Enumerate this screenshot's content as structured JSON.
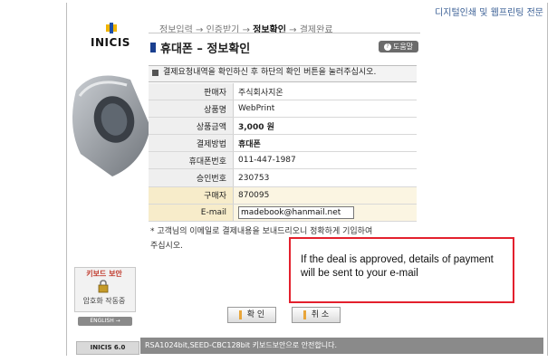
{
  "header": {
    "banner": "디지털인쇄 및 웹프린팅 전문",
    "steps": [
      "정보입력",
      "인증받기",
      "정보확인",
      "결제완료"
    ],
    "step_arrow": "→",
    "active_step": "정보확인"
  },
  "brand": {
    "logo_text": "INICIS",
    "badge_text": "INICIS 6.0"
  },
  "keyboard_security": {
    "title": "키보드 보안",
    "status": "암호화 작동중",
    "english_label": "ENGLISH →"
  },
  "page": {
    "title": "휴대폰 – 정보확인",
    "help_label": "도움말",
    "notice": "결제요청내역을 확인하신 후 하단의 확인 버튼을 눌러주십시오."
  },
  "details": [
    {
      "label": "판매자",
      "value": "주식회사지온"
    },
    {
      "label": "상품명",
      "value": "WebPrint"
    },
    {
      "label": "상품금액",
      "value": "3,000 원"
    },
    {
      "label": "결제방법",
      "value": "휴대폰"
    },
    {
      "label": "휴대폰번호",
      "value": "011-447-1987"
    },
    {
      "label": "승인번호",
      "value": "230753"
    },
    {
      "label": "구매자",
      "value": "870095"
    }
  ],
  "email": {
    "label": "E-mail",
    "value": "madebook@hanmail.net"
  },
  "footnote": {
    "line1": "* 고객님의 이메일로 결제내용을 보내드리오니 정확하게 기입하여",
    "line2": "주십시오."
  },
  "callout": {
    "text": "If the deal is approved, details of payment will be sent to your e-mail"
  },
  "buttons": {
    "confirm": "확 인",
    "cancel": "취 소"
  },
  "footer": {
    "text": "RSA1024bit,SEED-CBC128bit 키보드보안으로 안전합니다."
  },
  "colors": {
    "callout_border": "#e3202d",
    "title_accent": "#1a3f8f",
    "buyer_row": "#f7ecca"
  }
}
